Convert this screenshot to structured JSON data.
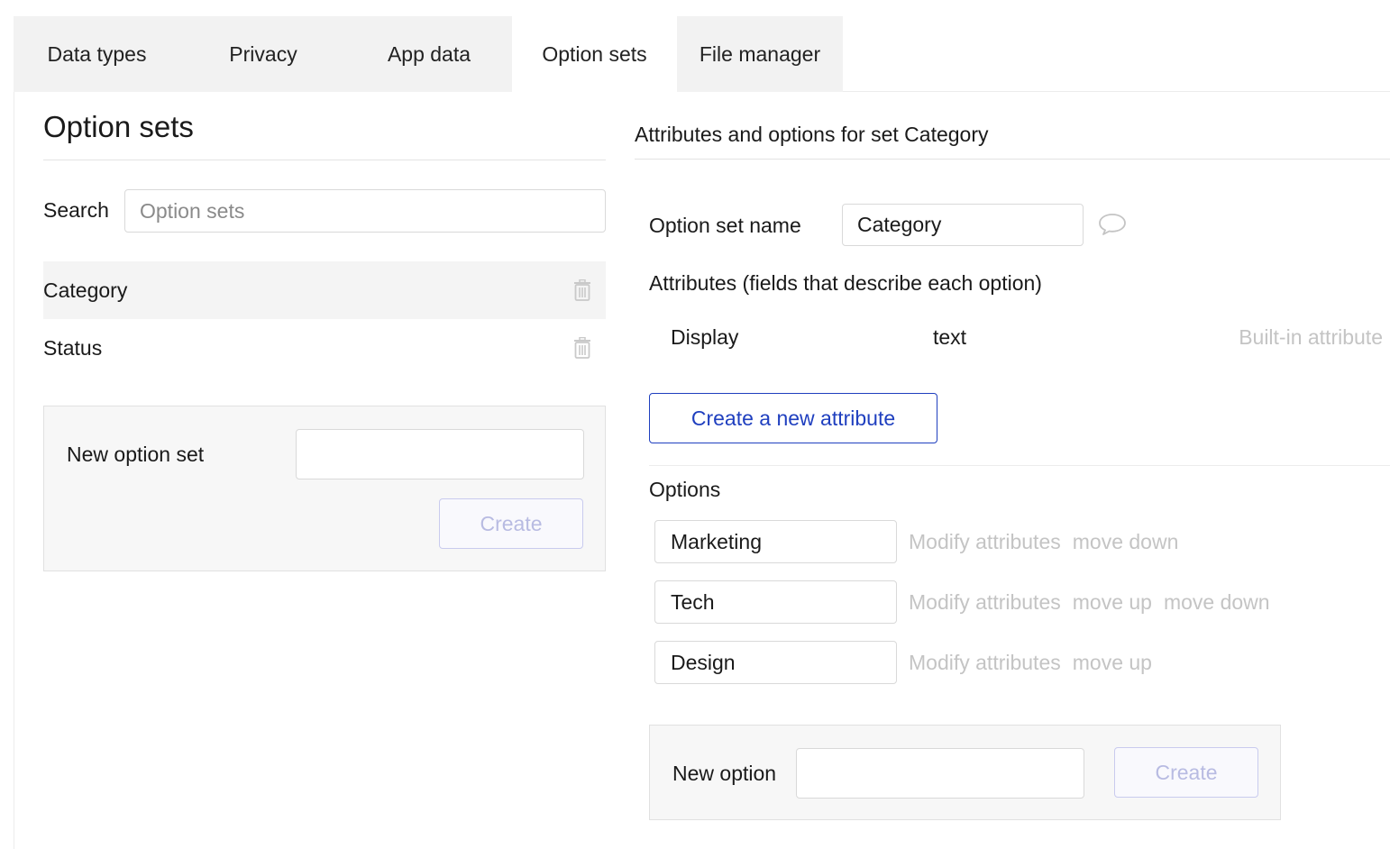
{
  "tabs": [
    {
      "label": "Data types",
      "active": false
    },
    {
      "label": "Privacy",
      "active": false
    },
    {
      "label": "App data",
      "active": false
    },
    {
      "label": "Option sets",
      "active": true
    },
    {
      "label": "File manager",
      "active": false
    }
  ],
  "left": {
    "title": "Option sets",
    "search_label": "Search",
    "search_placeholder": "Option sets",
    "search_value": "",
    "sets": [
      {
        "name": "Category",
        "selected": true,
        "delete_icon": "trash-icon"
      },
      {
        "name": "Status",
        "selected": false,
        "delete_icon": "trash-icon"
      }
    ],
    "new_set": {
      "label": "New option set",
      "value": "",
      "create_label": "Create"
    }
  },
  "right": {
    "title": "Attributes and options for set Category",
    "name_label": "Option set name",
    "name_value": "Category",
    "comment_icon": "speech-bubble-icon",
    "attributes_heading": "Attributes (fields that describe each option)",
    "attributes": [
      {
        "name": "Display",
        "type": "text",
        "note": "Built-in attribute"
      }
    ],
    "create_attribute_label": "Create a new attribute",
    "options_heading": "Options",
    "options": [
      {
        "value": "Marketing",
        "modify": "Modify attributes",
        "move_up": "",
        "move_down": "move down"
      },
      {
        "value": "Tech",
        "modify": "Modify attributes",
        "move_up": "move up",
        "move_down": "move down"
      },
      {
        "value": "Design",
        "modify": "Modify attributes",
        "move_up": "move up",
        "move_down": ""
      }
    ],
    "new_option": {
      "label": "New option",
      "value": "",
      "create_label": "Create"
    }
  },
  "colors": {
    "accent": "#1f3fbf",
    "muted_text": "#c4c4c4",
    "tab_bg": "#f2f2f2",
    "disabled_button_text": "#b8bbe2"
  }
}
